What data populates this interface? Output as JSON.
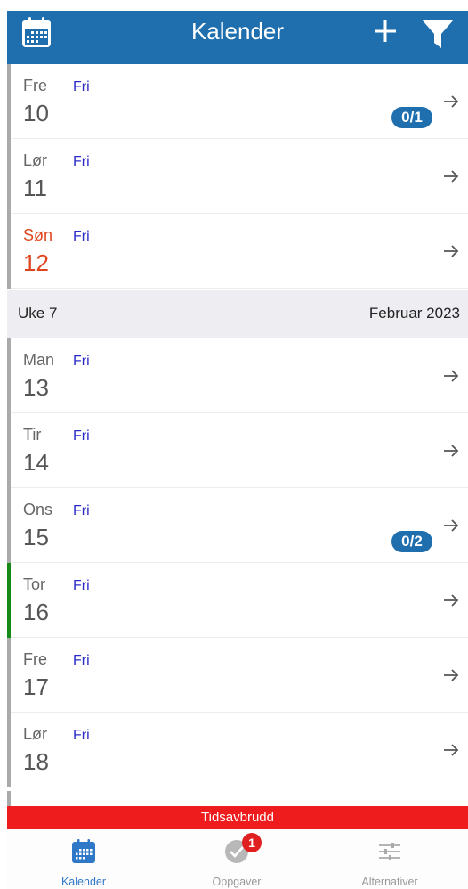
{
  "header": {
    "title": "Kalender",
    "icons": {
      "calendar": "calendar-icon",
      "add": "plus-icon",
      "filter": "filter-icon"
    },
    "color": "#1f6fae"
  },
  "days_before": [
    {
      "dow": "Fre",
      "date": "10",
      "status": "Fri",
      "badge": "0/1"
    },
    {
      "dow": "Lør",
      "date": "11",
      "status": "Fri"
    },
    {
      "dow": "Søn",
      "date": "12",
      "status": "Fri",
      "sunday": true
    }
  ],
  "week": {
    "label": "Uke 7",
    "month": "Februar 2023"
  },
  "days_after": [
    {
      "dow": "Man",
      "date": "13",
      "status": "Fri"
    },
    {
      "dow": "Tir",
      "date": "14",
      "status": "Fri"
    },
    {
      "dow": "Ons",
      "date": "15",
      "status": "Fri",
      "badge": "0/2"
    },
    {
      "dow": "Tor",
      "date": "16",
      "status": "Fri",
      "today": true
    },
    {
      "dow": "Fre",
      "date": "17",
      "status": "Fri"
    },
    {
      "dow": "Lør",
      "date": "18",
      "status": "Fri"
    }
  ],
  "banner": {
    "text": "Tidsavbrudd",
    "color": "#ee1c1c"
  },
  "tabs": {
    "calendar": {
      "label": "Kalender",
      "icon": "calendar-icon"
    },
    "tasks": {
      "label": "Oppgaver",
      "icon": "check-circle-icon",
      "badge": "1"
    },
    "options": {
      "label": "Alternativer",
      "icon": "sliders-icon"
    }
  }
}
